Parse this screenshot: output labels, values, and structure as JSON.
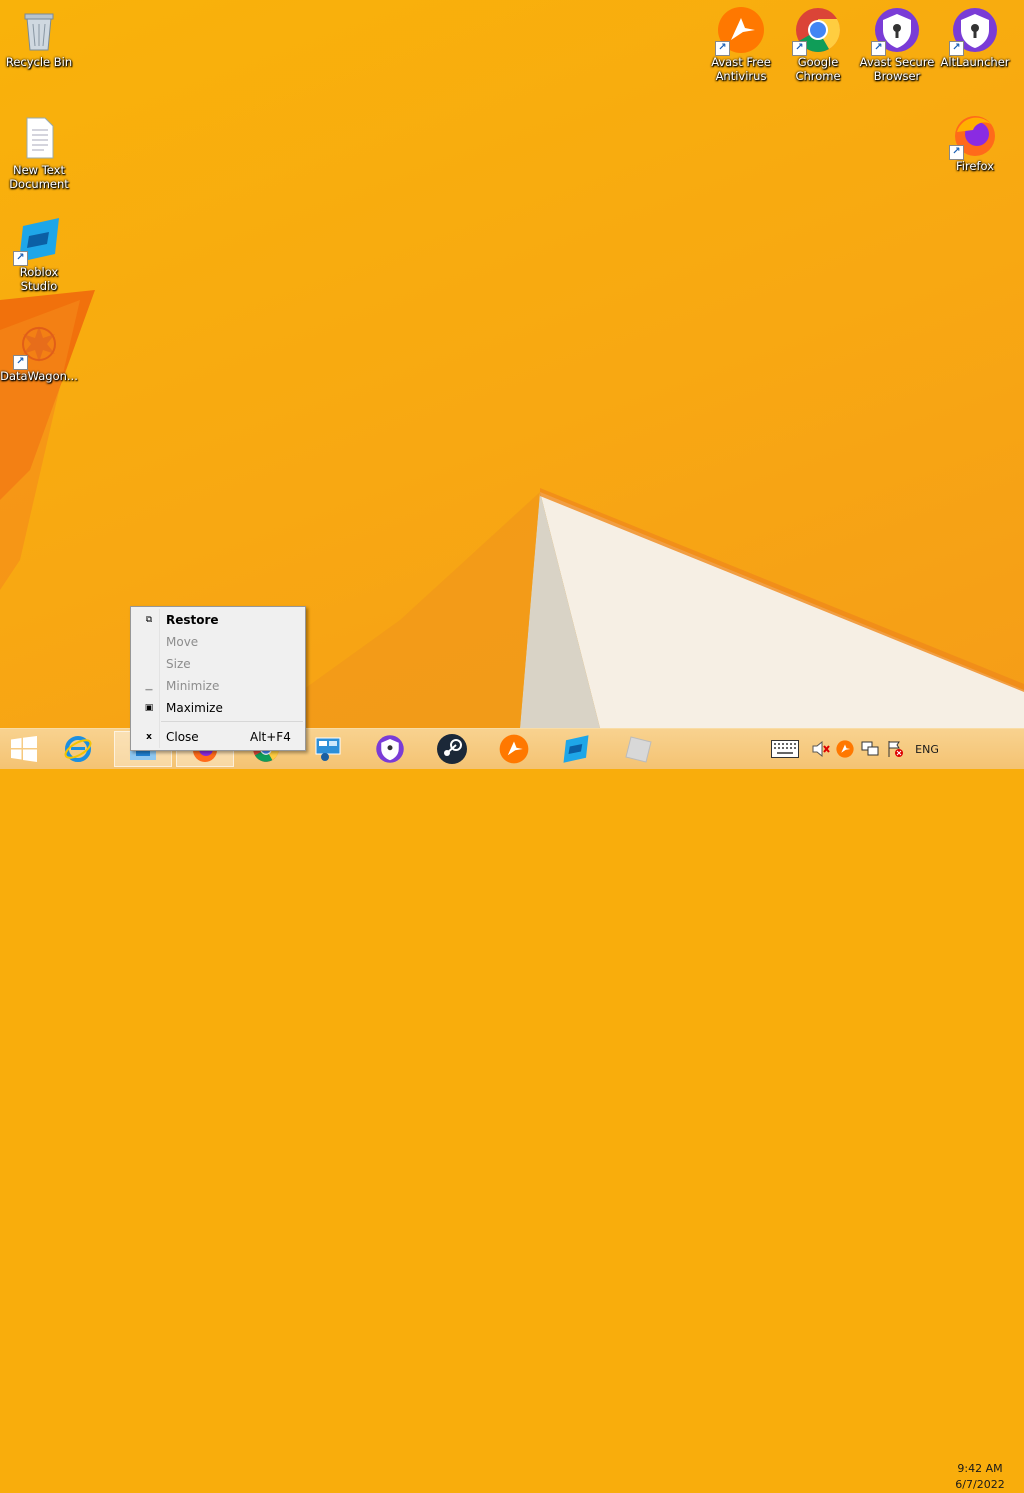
{
  "desktop": {
    "icons": [
      {
        "name": "recycle-bin",
        "label": "Recycle Bin"
      },
      {
        "name": "new-text-document",
        "label": "New Text Document"
      },
      {
        "name": "roblox-studio",
        "label": "Roblox Studio"
      },
      {
        "name": "datawagon",
        "label": "DataWagon..."
      },
      {
        "name": "avast-free-antivirus",
        "label": "Avast Free Antivirus"
      },
      {
        "name": "google-chrome",
        "label": "Google Chrome"
      },
      {
        "name": "avast-secure-browser",
        "label": "Avast Secure Browser"
      },
      {
        "name": "altlauncher",
        "label": "AltLauncher"
      },
      {
        "name": "firefox",
        "label": "Firefox"
      }
    ]
  },
  "context_menu": {
    "items": [
      {
        "label": "Restore",
        "enabled": true,
        "bold": true,
        "icon": "restore-icon"
      },
      {
        "label": "Move",
        "enabled": false,
        "icon": ""
      },
      {
        "label": "Size",
        "enabled": false,
        "icon": ""
      },
      {
        "label": "Minimize",
        "enabled": false,
        "icon": "minimize-icon"
      },
      {
        "label": "Maximize",
        "enabled": true,
        "icon": "maximize-icon"
      },
      {
        "label": "Close",
        "enabled": true,
        "accelerator": "Alt+F4",
        "icon": "close-icon"
      }
    ]
  },
  "taskbar": {
    "language": "ENG",
    "time": "9:42 AM",
    "date": "6/7/2022",
    "apps": [
      "start",
      "internet-explorer",
      "file-explorer",
      "firefox",
      "chrome",
      "remote-desktop",
      "avast-secure-browser",
      "steam",
      "avast-antivirus",
      "roblox-studio",
      "roblox-player"
    ]
  },
  "colors": {
    "wallpaper": "#f9ad0c",
    "accent": "#f5891f",
    "taskbar": "#f4c57c"
  }
}
